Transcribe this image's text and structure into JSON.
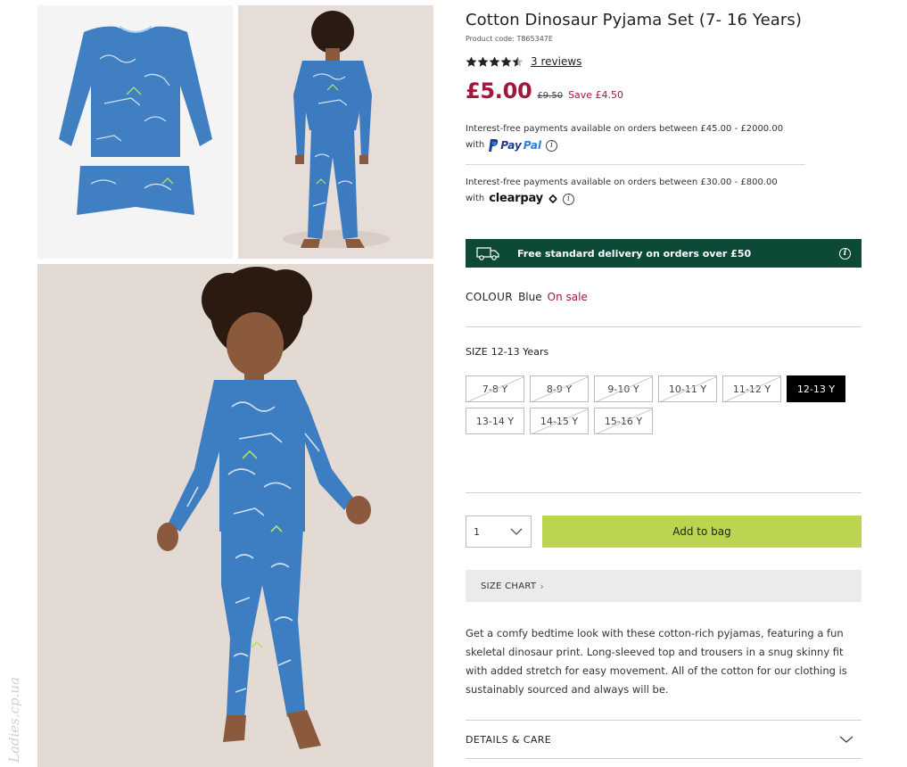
{
  "product": {
    "title": "Cotton Dinosaur Pyjama Set (7- 16 Years)",
    "code": "Product code: T865347E",
    "rating_stars": 4.5,
    "reviews": "3 reviews",
    "price_now": "£5.00",
    "price_was": "£9.50",
    "price_save": "Save £4.50",
    "accent_color": "#a5173a"
  },
  "payments": {
    "paypal_text": "Interest-free payments available on orders between £45.00 - £2000.00",
    "paypal_with": "with",
    "paypal_brand_p": "Pay",
    "paypal_brand_pal": "Pal",
    "clearpay_text": "Interest-free payments available on orders between £30.00 - £800.00",
    "clearpay_with": "with",
    "clearpay_brand": "clearpay",
    "info_icon": "i"
  },
  "delivery": {
    "text": "Free standard delivery on orders over £50",
    "icon": "truck-icon",
    "bg_color": "#0c4a37"
  },
  "colour": {
    "label": "COLOUR",
    "value": "Blue",
    "status": "On sale"
  },
  "size": {
    "label": "SIZE",
    "selected": "12-13 Years",
    "options": [
      {
        "label": "7-8 Y",
        "available": false
      },
      {
        "label": "8-9 Y",
        "available": false
      },
      {
        "label": "9-10 Y",
        "available": false
      },
      {
        "label": "10-11 Y",
        "available": false
      },
      {
        "label": "11-12 Y",
        "available": false
      },
      {
        "label": "12-13 Y",
        "available": true
      },
      {
        "label": "13-14 Y",
        "available": true
      },
      {
        "label": "14-15 Y",
        "available": false
      },
      {
        "label": "15-16 Y",
        "available": false
      }
    ]
  },
  "purchase": {
    "quantity": "1",
    "add_to_bag": "Add to bag",
    "button_color": "#bcd551"
  },
  "size_chart": {
    "label": "SIZE CHART",
    "chevron": "›"
  },
  "description": "Get a comfy bedtime look with these cotton-rich pyjamas, featuring a fun skeletal dinosaur print. Long-sleeved top and trousers in a snug skinny fit with added stretch for easy movement. All of the cotton for our clothing is sustainably sourced and always will be.",
  "details": {
    "label": "DETAILS & CARE"
  },
  "watermark": "Ladies.cp.ua"
}
